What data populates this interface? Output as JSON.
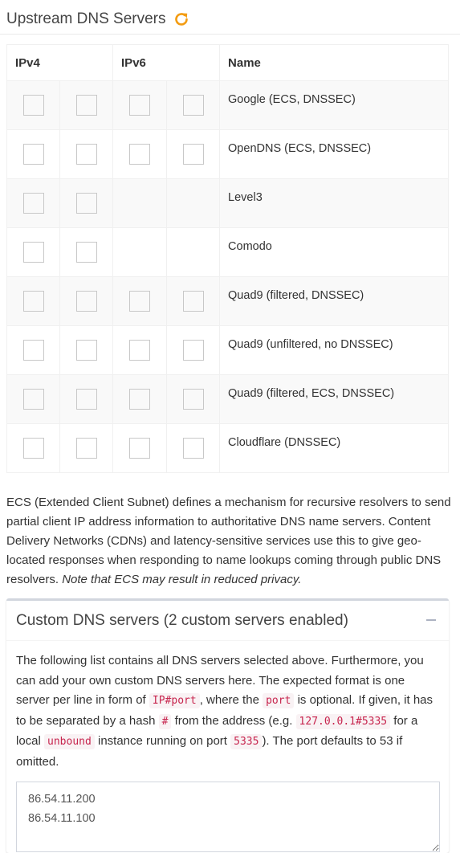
{
  "header": {
    "title": "Upstream DNS Servers",
    "refresh_icon": "refresh-icon",
    "refresh_color": "#f39c12"
  },
  "table": {
    "headers": {
      "ipv4": "IPv4",
      "ipv6": "IPv6",
      "name": "Name"
    },
    "rows": [
      {
        "name": "Google (ECS, DNSSEC)",
        "ipv4": [
          false,
          false
        ],
        "ipv6": [
          false,
          false
        ]
      },
      {
        "name": "OpenDNS (ECS, DNSSEC)",
        "ipv4": [
          false,
          false
        ],
        "ipv6": [
          false,
          false
        ]
      },
      {
        "name": "Level3",
        "ipv4": [
          false,
          false
        ],
        "ipv6": []
      },
      {
        "name": "Comodo",
        "ipv4": [
          false,
          false
        ],
        "ipv6": []
      },
      {
        "name": "Quad9 (filtered, DNSSEC)",
        "ipv4": [
          false,
          false
        ],
        "ipv6": [
          false,
          false
        ]
      },
      {
        "name": "Quad9 (unfiltered, no DNSSEC)",
        "ipv4": [
          false,
          false
        ],
        "ipv6": [
          false,
          false
        ]
      },
      {
        "name": "Quad9 (filtered, ECS, DNSSEC)",
        "ipv4": [
          false,
          false
        ],
        "ipv6": [
          false,
          false
        ]
      },
      {
        "name": "Cloudflare (DNSSEC)",
        "ipv4": [
          false,
          false
        ],
        "ipv6": [
          false,
          false
        ]
      }
    ]
  },
  "ecs": {
    "text": "ECS (Extended Client Subnet) defines a mechanism for recursive resolvers to send partial client IP address information to authoritative DNS name servers. Content Delivery Networks (CDNs) and latency-sensitive services use this to give geo-located responses when responding to name lookups coming through public DNS resolvers.",
    "note": "Note that ECS may result in reduced privacy."
  },
  "custom": {
    "title": "Custom DNS servers (2 custom servers enabled)",
    "collapse_icon": "minus-icon",
    "desc_1": "The following list contains all DNS servers selected above. Furthermore, you can add your own custom DNS servers here. The expected format is one server per line in form of",
    "code_1": "IP#port",
    "desc_2": ", where the",
    "code_2": "port",
    "desc_3": "is optional. If given, it has to be separated by a hash",
    "code_3": "#",
    "desc_4": "from the address (e.g.",
    "code_4": "127.0.0.1#5335",
    "desc_5": "for a local",
    "code_5": "unbound",
    "desc_6": "instance running on port",
    "code_6": "5335",
    "desc_7": "). The port defaults to 53 if omitted.",
    "servers_value": "86.54.11.200\n86.54.11.100"
  }
}
